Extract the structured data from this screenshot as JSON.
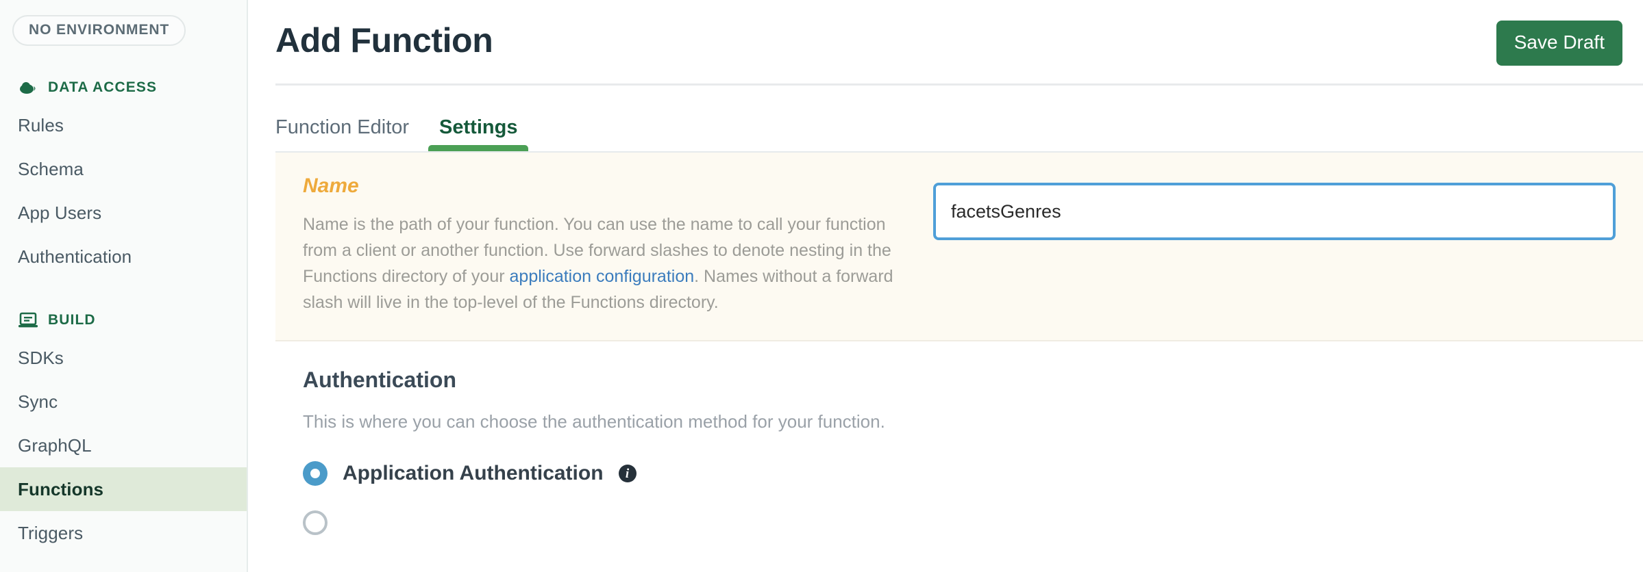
{
  "sidebar": {
    "environment_pill": "NO ENVIRONMENT",
    "sections": [
      {
        "label": "DATA ACCESS",
        "icon": "cloud-icon",
        "items": [
          {
            "label": "Rules",
            "active": false
          },
          {
            "label": "Schema",
            "active": false
          },
          {
            "label": "App Users",
            "active": false
          },
          {
            "label": "Authentication",
            "active": false
          }
        ]
      },
      {
        "label": "BUILD",
        "icon": "laptop-icon",
        "items": [
          {
            "label": "SDKs",
            "active": false
          },
          {
            "label": "Sync",
            "active": false
          },
          {
            "label": "GraphQL",
            "active": false
          },
          {
            "label": "Functions",
            "active": true
          },
          {
            "label": "Triggers",
            "active": false
          }
        ]
      }
    ]
  },
  "header": {
    "title": "Add Function",
    "save_label": "Save Draft"
  },
  "tabs": [
    {
      "label": "Function Editor",
      "active": false
    },
    {
      "label": "Settings",
      "active": true
    }
  ],
  "name_panel": {
    "heading": "Name",
    "desc_part1": "Name is the path of your function. You can use the name to call your function from a client or another function. Use forward slashes to denote nesting in the Functions directory of your ",
    "link_text": "application configuration",
    "desc_part2": ". Names without a forward slash will live in the top-level of the Functions directory.",
    "input_value": "facetsGenres",
    "input_placeholder": ""
  },
  "authentication": {
    "title": "Authentication",
    "description": "This is where you can choose the authentication method for your function.",
    "options": [
      {
        "label": "Application Authentication",
        "selected": true,
        "info": "i"
      },
      {
        "label": "",
        "selected": false,
        "info": ""
      }
    ]
  },
  "colors": {
    "brand_green": "#2d7a4d",
    "accent_blue": "#4f9fd8",
    "name_amber": "#eeaa3c",
    "active_nav_bg": "#dfead9",
    "panel_cream": "#fdfaf2"
  }
}
